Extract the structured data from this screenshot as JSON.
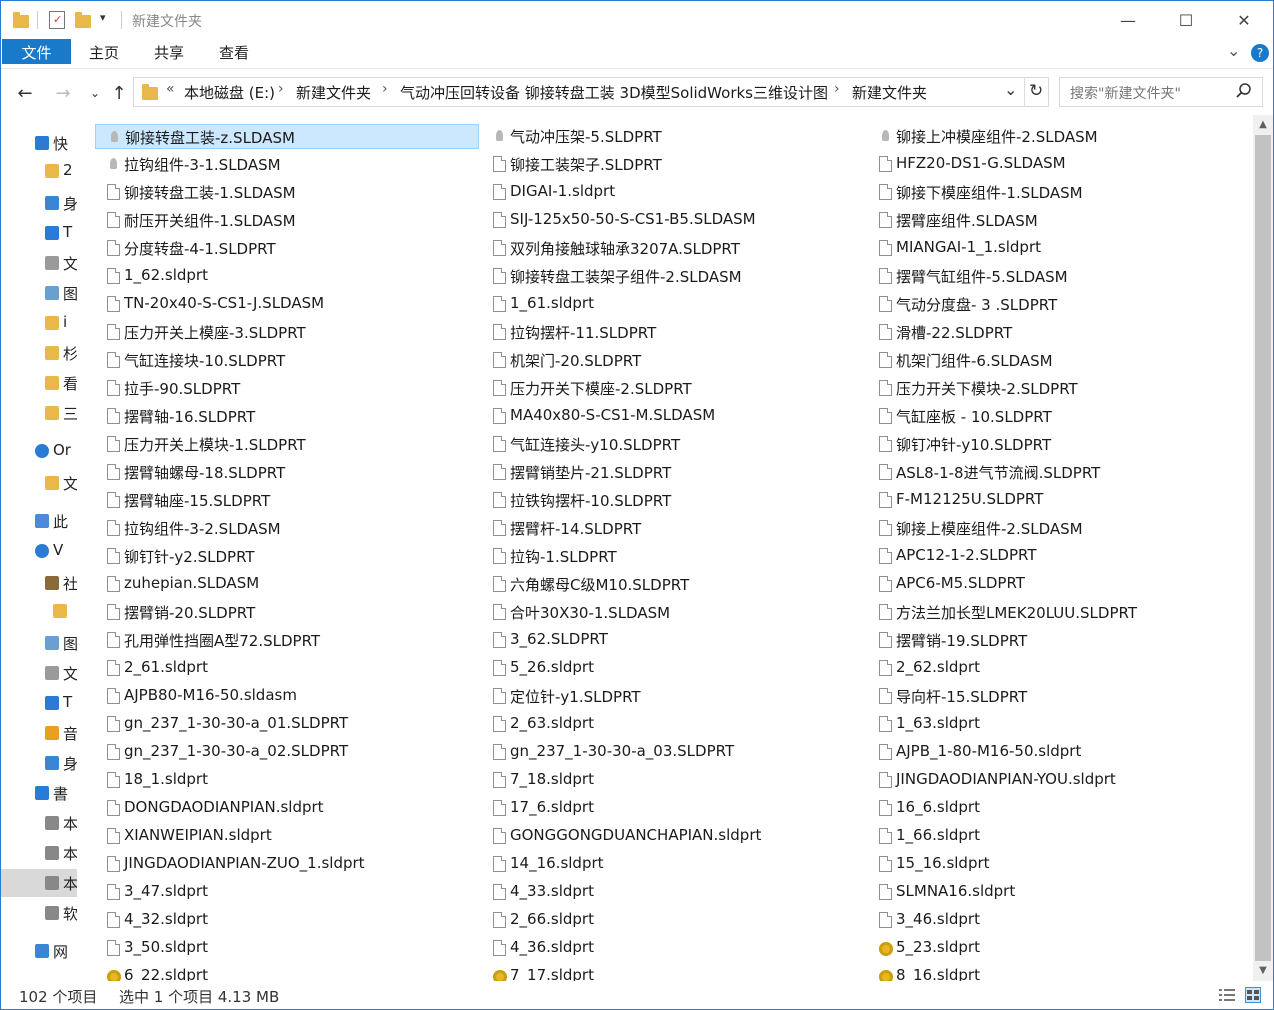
{
  "window": {
    "title": "新建文件夹",
    "controls": [
      "—",
      "☐",
      "✕"
    ]
  },
  "ribbon": {
    "tabs": [
      "文件",
      "主页",
      "共享",
      "查看"
    ],
    "expand": "⌄",
    "help": "?"
  },
  "address": {
    "overflow": "«",
    "crumbs": [
      "本地磁盘 (E:)",
      "新建文件夹",
      "气动冲压回转设备 铆接转盘工装 3D模型SolidWorks三维设计图",
      "新建文件夹"
    ],
    "dropdown": "⌄",
    "refresh": "↻"
  },
  "search": {
    "placeholder": "搜索\"新建文件夹\""
  },
  "navpane": {
    "items": [
      {
        "icon": "star-icon",
        "label": "快"
      },
      {
        "icon": "folder-icon",
        "label": "2"
      },
      {
        "icon": "desktop-icon",
        "label": "身"
      },
      {
        "icon": "download-icon",
        "label": "T"
      },
      {
        "icon": "document-icon",
        "label": "文"
      },
      {
        "icon": "picture-icon",
        "label": "图"
      },
      {
        "icon": "folder-icon",
        "label": "i"
      },
      {
        "icon": "folder-icon",
        "label": "杉"
      },
      {
        "icon": "folder-icon",
        "label": "看"
      },
      {
        "icon": "folder-icon",
        "label": "三"
      },
      {
        "icon": "cloud-icon",
        "label": "Or"
      },
      {
        "icon": "folder-icon",
        "label": "文"
      },
      {
        "icon": "computer-icon",
        "label": "此"
      },
      {
        "icon": "cloud-icon",
        "label": "V"
      },
      {
        "icon": "video-icon",
        "label": "社"
      },
      {
        "icon": "folder-icon",
        "label": ""
      },
      {
        "icon": "picture-icon",
        "label": "图"
      },
      {
        "icon": "document-icon",
        "label": "文"
      },
      {
        "icon": "download-icon",
        "label": "T"
      },
      {
        "icon": "music-icon",
        "label": "音"
      },
      {
        "icon": "desktop-icon",
        "label": "身"
      },
      {
        "icon": "windows-icon",
        "label": "書"
      },
      {
        "icon": "drive-icon",
        "label": "本"
      },
      {
        "icon": "drive-icon",
        "label": "本"
      },
      {
        "icon": "drive-icon",
        "label": "本"
      },
      {
        "icon": "drive-icon",
        "label": "软"
      },
      {
        "icon": "network-icon",
        "label": "网"
      }
    ],
    "selected_index": 24
  },
  "files": {
    "col1": [
      {
        "name": "铆接转盘工装-z.SLDASM",
        "icon": "sw"
      },
      {
        "name": "拉钩组件-3-1.SLDASM",
        "icon": "sw"
      },
      {
        "name": "铆接转盘工装-1.SLDASM",
        "icon": "doc"
      },
      {
        "name": "耐压开关组件-1.SLDASM",
        "icon": "doc"
      },
      {
        "name": "分度转盘-4-1.SLDPRT",
        "icon": "doc"
      },
      {
        "name": "1_62.sldprt",
        "icon": "doc"
      },
      {
        "name": "TN-20x40-S-CS1-J.SLDASM",
        "icon": "doc"
      },
      {
        "name": "压力开关上模座-3.SLDPRT",
        "icon": "doc"
      },
      {
        "name": "气缸连接块-10.SLDPRT",
        "icon": "doc"
      },
      {
        "name": "拉手-90.SLDPRT",
        "icon": "doc"
      },
      {
        "name": "摆臂轴-16.SLDPRT",
        "icon": "doc"
      },
      {
        "name": "压力开关上模块-1.SLDPRT",
        "icon": "doc"
      },
      {
        "name": "摆臂轴螺母-18.SLDPRT",
        "icon": "doc"
      },
      {
        "name": "摆臂轴座-15.SLDPRT",
        "icon": "doc"
      },
      {
        "name": "拉钩组件-3-2.SLDASM",
        "icon": "doc"
      },
      {
        "name": "铆钉针-y2.SLDPRT",
        "icon": "doc"
      },
      {
        "name": "zuhepian.SLDASM",
        "icon": "doc"
      },
      {
        "name": "摆臂销-20.SLDPRT",
        "icon": "doc"
      },
      {
        "name": "孔用弹性挡圈A型72.SLDPRT",
        "icon": "doc"
      },
      {
        "name": "2_61.sldprt",
        "icon": "doc"
      },
      {
        "name": "AJPB80-M16-50.sldasm",
        "icon": "doc"
      },
      {
        "name": "gn_237_1-30-30-a_01.SLDPRT",
        "icon": "doc"
      },
      {
        "name": "gn_237_1-30-30-a_02.SLDPRT",
        "icon": "doc"
      },
      {
        "name": "18_1.sldprt",
        "icon": "doc"
      },
      {
        "name": "DONGDAODIANPIAN.sldprt",
        "icon": "doc"
      },
      {
        "name": "XIANWEIPIAN.sldprt",
        "icon": "doc"
      },
      {
        "name": "JINGDAODIANPIAN-ZUO_1.sldprt",
        "icon": "doc"
      },
      {
        "name": "3_47.sldprt",
        "icon": "doc"
      },
      {
        "name": "4_32.sldprt",
        "icon": "doc"
      },
      {
        "name": "3_50.sldprt",
        "icon": "doc"
      },
      {
        "name": "6_22.sldprt",
        "icon": "gear"
      }
    ],
    "col2": [
      {
        "name": "气动冲压架-5.SLDPRT",
        "icon": "sw"
      },
      {
        "name": "铆接工装架子.SLDPRT",
        "icon": "doc"
      },
      {
        "name": "DIGAI-1.sldprt",
        "icon": "doc"
      },
      {
        "name": "SIJ-125x50-50-S-CS1-B5.SLDASM",
        "icon": "doc"
      },
      {
        "name": "双列角接触球轴承3207A.SLDPRT",
        "icon": "doc"
      },
      {
        "name": "铆接转盘工装架子组件-2.SLDASM",
        "icon": "doc"
      },
      {
        "name": "1_61.sldprt",
        "icon": "doc"
      },
      {
        "name": "拉钩摆杆-11.SLDPRT",
        "icon": "doc"
      },
      {
        "name": "机架门-20.SLDPRT",
        "icon": "doc"
      },
      {
        "name": "压力开关下模座-2.SLDPRT",
        "icon": "doc"
      },
      {
        "name": "MA40x80-S-CS1-M.SLDASM",
        "icon": "doc"
      },
      {
        "name": "气缸连接头-y10.SLDPRT",
        "icon": "doc"
      },
      {
        "name": "摆臂销垫片-21.SLDPRT",
        "icon": "doc"
      },
      {
        "name": "拉铁钩摆杆-10.SLDPRT",
        "icon": "doc"
      },
      {
        "name": "摆臂杆-14.SLDPRT",
        "icon": "doc"
      },
      {
        "name": "拉钩-1.SLDPRT",
        "icon": "doc"
      },
      {
        "name": "六角螺母C级M10.SLDPRT",
        "icon": "doc"
      },
      {
        "name": "合叶30X30-1.SLDASM",
        "icon": "doc"
      },
      {
        "name": "3_62.SLDPRT",
        "icon": "doc"
      },
      {
        "name": "5_26.sldprt",
        "icon": "doc"
      },
      {
        "name": "定位针-y1.SLDPRT",
        "icon": "doc"
      },
      {
        "name": "2_63.sldprt",
        "icon": "doc"
      },
      {
        "name": "gn_237_1-30-30-a_03.SLDPRT",
        "icon": "doc"
      },
      {
        "name": "7_18.sldprt",
        "icon": "doc"
      },
      {
        "name": "17_6.sldprt",
        "icon": "doc"
      },
      {
        "name": "GONGGONGDUANCHAPIAN.sldprt",
        "icon": "doc"
      },
      {
        "name": "14_16.sldprt",
        "icon": "doc"
      },
      {
        "name": "4_33.sldprt",
        "icon": "doc"
      },
      {
        "name": "2_66.sldprt",
        "icon": "doc"
      },
      {
        "name": "4_36.sldprt",
        "icon": "doc"
      },
      {
        "name": "7_17.sldprt",
        "icon": "gear"
      }
    ],
    "col3": [
      {
        "name": "铆接上冲模座组件-2.SLDASM",
        "icon": "sw"
      },
      {
        "name": "HFZ20-DS1-G.SLDASM",
        "icon": "doc"
      },
      {
        "name": "铆接下模座组件-1.SLDASM",
        "icon": "doc"
      },
      {
        "name": "摆臂座组件.SLDASM",
        "icon": "doc"
      },
      {
        "name": "MIANGAI-1_1.sldprt",
        "icon": "doc"
      },
      {
        "name": "摆臂气缸组件-5.SLDASM",
        "icon": "doc"
      },
      {
        "name": "气动分度盘- 3 .SLDPRT",
        "icon": "doc"
      },
      {
        "name": "滑槽-22.SLDPRT",
        "icon": "doc"
      },
      {
        "name": "机架门组件-6.SLDASM",
        "icon": "doc"
      },
      {
        "name": "压力开关下模块-2.SLDPRT",
        "icon": "doc"
      },
      {
        "name": "气缸座板 - 10.SLDPRT",
        "icon": "doc"
      },
      {
        "name": "铆钉冲针-y10.SLDPRT",
        "icon": "doc"
      },
      {
        "name": "ASL8-1-8进气节流阀.SLDPRT",
        "icon": "doc"
      },
      {
        "name": "F-M12125U.SLDPRT",
        "icon": "doc"
      },
      {
        "name": "铆接上模座组件-2.SLDASM",
        "icon": "doc"
      },
      {
        "name": "APC12-1-2.SLDPRT",
        "icon": "doc"
      },
      {
        "name": "APC6-M5.SLDPRT",
        "icon": "doc"
      },
      {
        "name": "方法兰加长型LMEK20LUU.SLDPRT",
        "icon": "doc"
      },
      {
        "name": "摆臂销-19.SLDPRT",
        "icon": "doc"
      },
      {
        "name": "2_62.sldprt",
        "icon": "doc"
      },
      {
        "name": "导向杆-15.SLDPRT",
        "icon": "doc"
      },
      {
        "name": "1_63.sldprt",
        "icon": "doc"
      },
      {
        "name": "AJPB_1-80-M16-50.sldprt",
        "icon": "doc"
      },
      {
        "name": "JINGDAODIANPIAN-YOU.sldprt",
        "icon": "doc"
      },
      {
        "name": "16_6.sldprt",
        "icon": "doc"
      },
      {
        "name": "1_66.sldprt",
        "icon": "doc"
      },
      {
        "name": "15_16.sldprt",
        "icon": "doc"
      },
      {
        "name": "SLMNA16.sldprt",
        "icon": "doc"
      },
      {
        "name": "3_46.sldprt",
        "icon": "doc"
      },
      {
        "name": "5_23.sldprt",
        "icon": "gear"
      },
      {
        "name": "8_16.sldprt",
        "icon": "gear"
      }
    ]
  },
  "status": {
    "count": "102 个项目",
    "selection": "选中 1 个项目  4.13 MB"
  }
}
